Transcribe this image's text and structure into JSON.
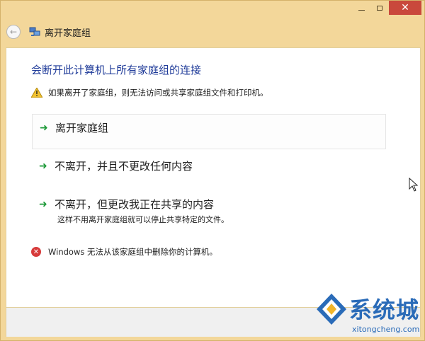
{
  "window": {
    "title": "离开家庭组"
  },
  "caption": {
    "minimize": "",
    "maximize": "",
    "close": "✕"
  },
  "content": {
    "heading": "会断开此计算机上所有家庭组的连接",
    "warning": "如果离开了家庭组，则无法访问或共享家庭组文件和打印机。",
    "options": [
      {
        "label": "离开家庭组",
        "description": ""
      },
      {
        "label": "不离开，并且不更改任何内容",
        "description": ""
      },
      {
        "label": "不离开，但更改我正在共享的内容",
        "description": "这样不用离开家庭组就可以停止共享特定的文件。"
      }
    ],
    "error": "Windows 无法从该家庭组中删除你的计算机。"
  },
  "watermark": {
    "text": "系统城",
    "url": "xitongcheng.com"
  },
  "colors": {
    "frame": "#f3d79a",
    "heading": "#1f3b99",
    "arrow": "#1f9a3a",
    "close": "#c9483c",
    "watermark": "#2a6bb8"
  }
}
